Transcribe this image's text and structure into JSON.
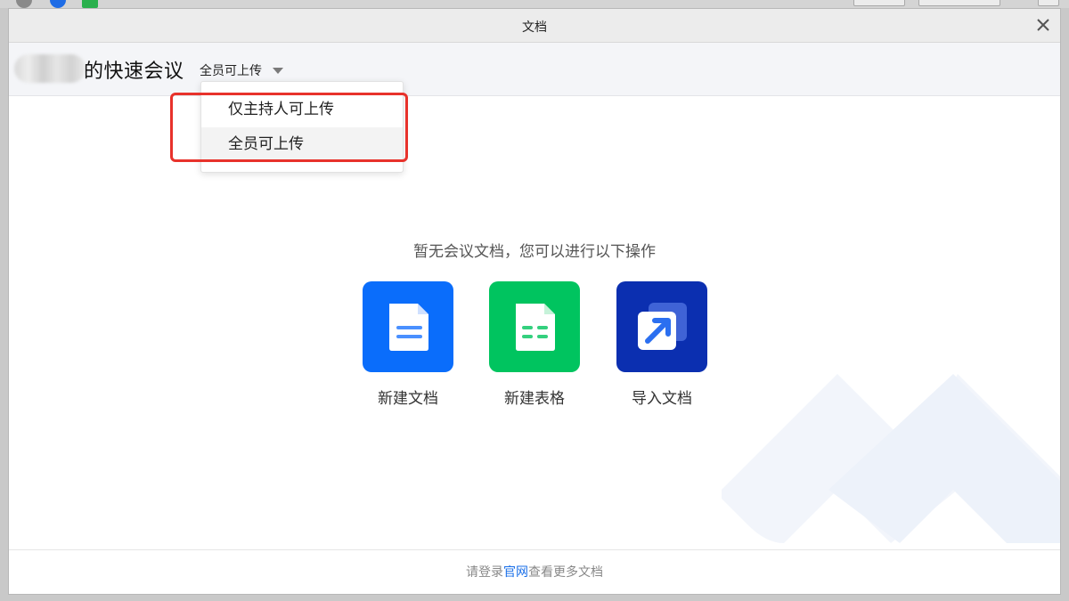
{
  "window": {
    "title": "文档"
  },
  "header": {
    "meeting_title": "的快速会议",
    "upload_permission": "全员可上传"
  },
  "permission_menu": {
    "options": [
      {
        "label": "仅主持人可上传"
      },
      {
        "label": "全员可上传",
        "selected": true
      }
    ]
  },
  "main": {
    "empty_message": "暂无会议文档，您可以进行以下操作",
    "actions": [
      {
        "label": "新建文档",
        "icon": "new-doc-icon",
        "color": "#0a6dfb"
      },
      {
        "label": "新建表格",
        "icon": "new-sheet-icon",
        "color": "#00c45f"
      },
      {
        "label": "导入文档",
        "icon": "import-doc-icon",
        "color": "#0b2fb0"
      }
    ]
  },
  "footer": {
    "text_before": "请登录",
    "link": "官网",
    "text_after": "查看更多文档"
  },
  "colors": {
    "highlight": "#e8322b",
    "link": "#1a6fe8"
  }
}
